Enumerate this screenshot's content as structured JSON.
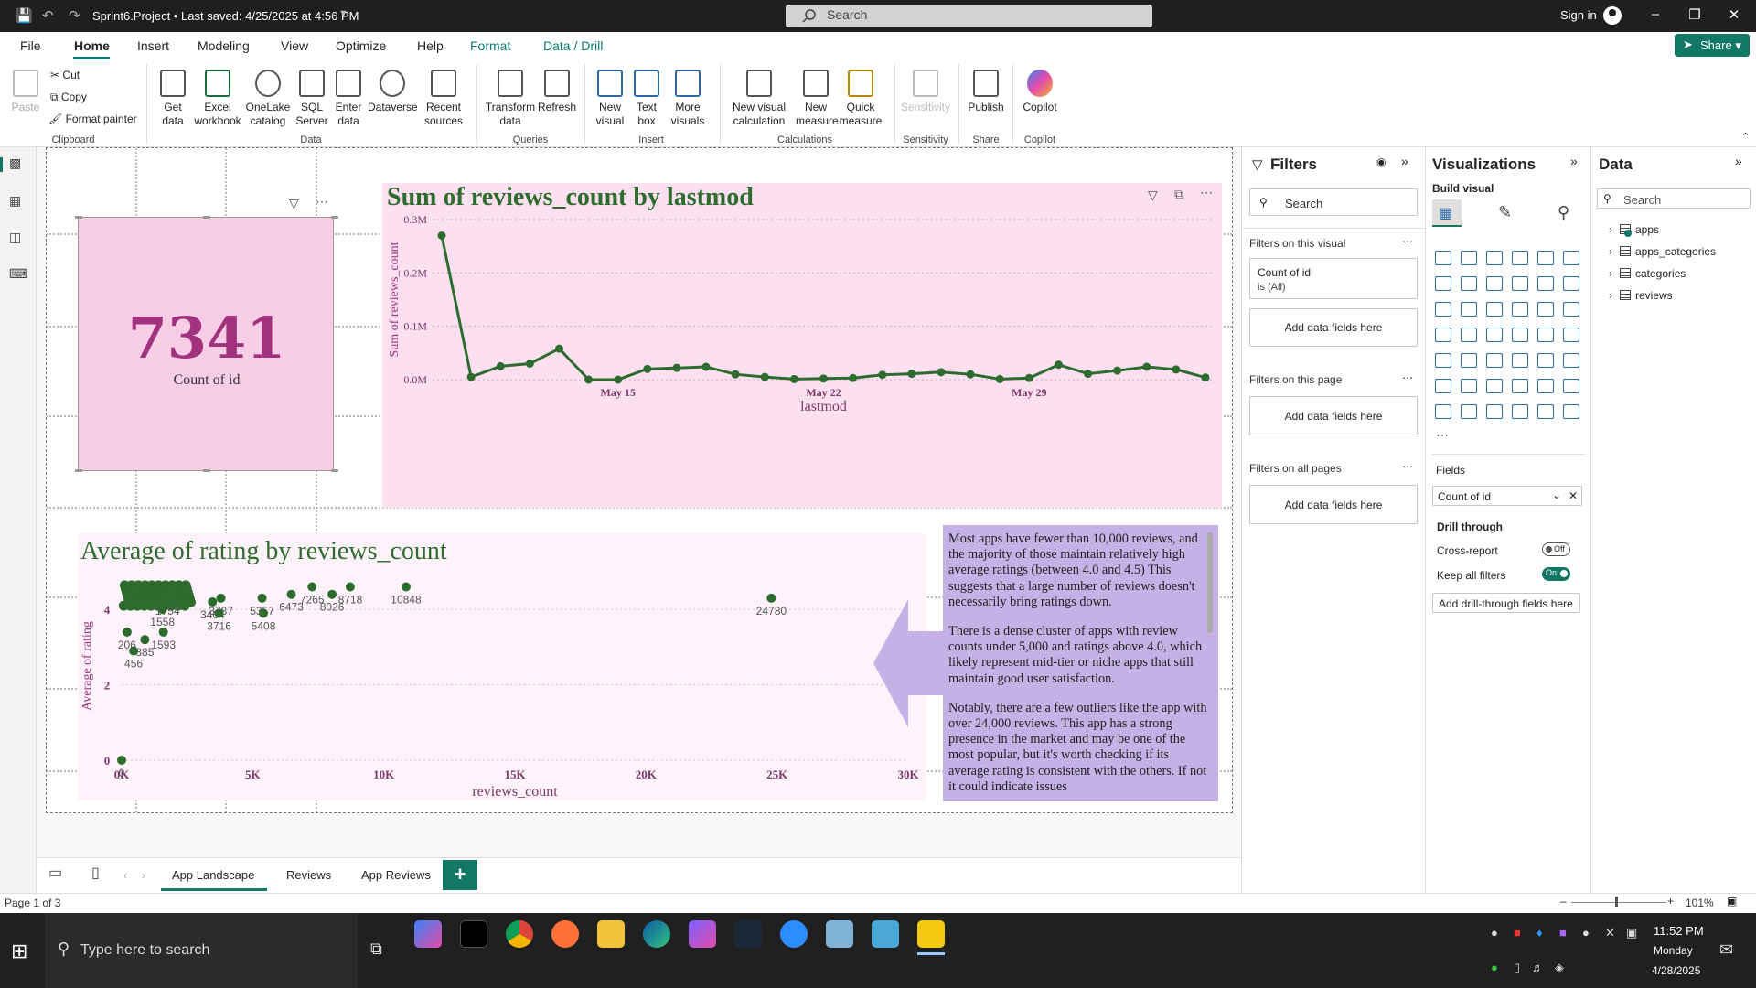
{
  "window": {
    "title": "Sprint6.Project • Last saved: 4/25/2025 at 4:56 PM",
    "search_placeholder": "Search",
    "signin": "Sign in"
  },
  "menu": [
    "File",
    "Home",
    "Insert",
    "Modeling",
    "View",
    "Optimize",
    "Help",
    "Format",
    "Data / Drill"
  ],
  "share_label": "Share",
  "ribbon": {
    "clipboard": {
      "paste": "Paste",
      "cut": "Cut",
      "copy": "Copy",
      "format_painter": "Format painter",
      "group": "Clipboard"
    },
    "data": {
      "get_data": "Get data",
      "excel": "Excel workbook",
      "onelake": "OneLake catalog",
      "sql": "SQL Server",
      "enter": "Enter data",
      "dataverse": "Dataverse",
      "recent": "Recent sources",
      "group": "Data"
    },
    "queries": {
      "transform": "Transform data",
      "refresh": "Refresh",
      "group": "Queries"
    },
    "insert": {
      "new_visual": "New visual",
      "text_box": "Text box",
      "more_visuals": "More visuals",
      "group": "Insert"
    },
    "calculations": {
      "new_visual_calc": "New visual calculation",
      "new_measure": "New measure",
      "quick_measure": "Quick measure",
      "group": "Calculations"
    },
    "sensitivity": {
      "label": "Sensitivity",
      "group": "Sensitivity"
    },
    "share": {
      "publish": "Publish",
      "group": "Share"
    },
    "copilot": {
      "label": "Copilot",
      "group": "Copilot"
    }
  },
  "card": {
    "value": "7341",
    "label": "Count of id"
  },
  "line_chart": {
    "title": "Sum of reviews_count by lastmod",
    "y_ticks": [
      "0.3M",
      "0.2M",
      "0.1M",
      "0.0M"
    ],
    "x_ticks": [
      "May 15",
      "May 22",
      "May 29"
    ],
    "xlabel": "lastmod",
    "ylabel": "Sum of reviews_count"
  },
  "scatter_chart": {
    "title": "Average of rating by reviews_count",
    "x_ticks": [
      "0K",
      "5K",
      "10K",
      "15K",
      "20K",
      "25K",
      "30K"
    ],
    "y_ticks": [
      "4",
      "2",
      "0"
    ],
    "xlabel": "reviews_count",
    "ylabel": "Average of rating",
    "point_labels": [
      "10848",
      "24780",
      "8718",
      "8026",
      "6473",
      "7265",
      "5357",
      "5408",
      "3787",
      "3464",
      "3716",
      "1754",
      "1558",
      "1593",
      "885",
      "456",
      "206",
      "0"
    ]
  },
  "chart_data": [
    {
      "type": "line",
      "title": "Sum of reviews_count by lastmod",
      "xlabel": "lastmod",
      "ylabel": "Sum of reviews_count",
      "ylim": [
        0,
        300000
      ],
      "x": [
        "May 9",
        "May 10",
        "May 11",
        "May 12",
        "May 13",
        "May 14",
        "May 15",
        "May 16",
        "May 17",
        "May 18",
        "May 19",
        "May 20",
        "May 21",
        "May 22",
        "May 23",
        "May 24",
        "May 25",
        "May 26",
        "May 27",
        "May 28",
        "May 29",
        "May 30",
        "May 31",
        "Jun 1",
        "Jun 2",
        "Jun 3",
        "Jun 4"
      ],
      "values": [
        270000,
        5000,
        25000,
        30000,
        58000,
        0,
        0,
        20000,
        22000,
        24000,
        10000,
        5000,
        1000,
        2000,
        3000,
        9000,
        11000,
        14000,
        10000,
        1000,
        3000,
        28000,
        11000,
        17000,
        24000,
        19000,
        4000
      ]
    },
    {
      "type": "scatter",
      "title": "Average of rating by reviews_count",
      "xlabel": "reviews_count",
      "ylabel": "Average of rating",
      "xlim": [
        0,
        30000
      ],
      "ylim": [
        0,
        5
      ],
      "points": [
        [
          10848,
          4.6
        ],
        [
          24780,
          4.3
        ],
        [
          8718,
          4.6
        ],
        [
          8026,
          4.4
        ],
        [
          6473,
          4.4
        ],
        [
          7265,
          4.6
        ],
        [
          5357,
          4.3
        ],
        [
          5408,
          3.9
        ],
        [
          3787,
          4.3
        ],
        [
          3464,
          4.2
        ],
        [
          3716,
          3.9
        ],
        [
          1754,
          4.3
        ],
        [
          1558,
          4.0
        ],
        [
          1593,
          3.4
        ],
        [
          885,
          3.2
        ],
        [
          456,
          2.9
        ],
        [
          206,
          3.4
        ],
        [
          0,
          0
        ]
      ]
    }
  ],
  "textbox": {
    "p1": "Most apps have fewer than 10,000 reviews, and the majority of those maintain relatively high average ratings (between 4.0 and 4.5) This suggests that a large number of reviews doesn't necessarily bring ratings down.",
    "p2": "There is a dense cluster of apps with review counts under 5,000 and ratings above 4.0, which likely represent mid-tier or niche apps that still maintain good user satisfaction.",
    "p3": "Notably, there are a few outliers like the app with over 24,000 reviews. This app has a strong presence in the market and may be one of the most popular, but it's worth checking if its average rating is consistent with the others. If not it could indicate issues"
  },
  "page_tabs": [
    "App Landscape",
    "Reviews",
    "App Reviews"
  ],
  "status": {
    "page": "Page 1 of 3",
    "zoom": "101%"
  },
  "filters": {
    "title": "Filters",
    "search": "Search",
    "on_visual": "Filters on this visual",
    "card_field": "Count of id",
    "card_state": "is (All)",
    "add": "Add data fields here",
    "on_page": "Filters on this page",
    "all_pages": "Filters on all pages"
  },
  "viz": {
    "title": "Visualizations",
    "build": "Build visual",
    "fields": "Fields",
    "field_value": "Count of id",
    "drill": "Drill through",
    "cross": "Cross-report",
    "cross_state": "Off",
    "keep": "Keep all filters",
    "keep_state": "On",
    "add_drill": "Add drill-through fields here"
  },
  "data_pane": {
    "title": "Data",
    "search": "Search",
    "tables": [
      "apps",
      "apps_categories",
      "categories",
      "reviews"
    ]
  },
  "taskbar": {
    "search": "Type here to search",
    "time": "11:52 PM",
    "day": "Monday",
    "date": "4/28/2025"
  }
}
